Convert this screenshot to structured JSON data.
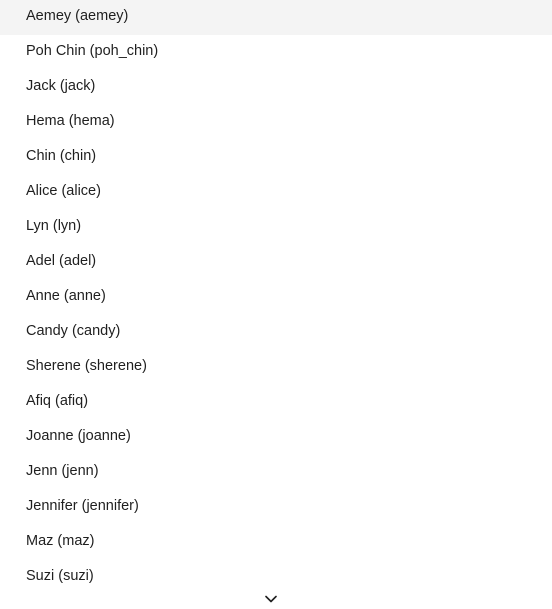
{
  "dropdown": {
    "highlighted_index": 0,
    "options": [
      {
        "label": "Aemey (aemey)"
      },
      {
        "label": "Poh Chin (poh_chin)"
      },
      {
        "label": "Jack (jack)"
      },
      {
        "label": "Hema (hema)"
      },
      {
        "label": "Chin (chin)"
      },
      {
        "label": "Alice (alice)"
      },
      {
        "label": "Lyn (lyn)"
      },
      {
        "label": "Adel (adel)"
      },
      {
        "label": "Anne (anne)"
      },
      {
        "label": "Candy (candy)"
      },
      {
        "label": "Sherene (sherene)"
      },
      {
        "label": "Afiq (afiq)"
      },
      {
        "label": "Joanne (joanne)"
      },
      {
        "label": "Jenn (jenn)"
      },
      {
        "label": "Jennifer (jennifer)"
      },
      {
        "label": "Maz (maz)"
      },
      {
        "label": "Suzi (suzi)"
      }
    ],
    "scroll_icon": "chevron-down-icon",
    "highlight_color": "#f4f4f4"
  }
}
